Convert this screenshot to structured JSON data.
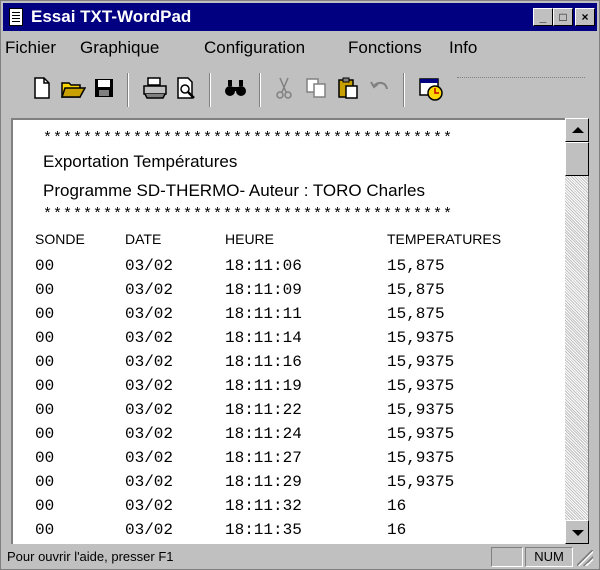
{
  "window": {
    "title": "Essai TXT-WordPad"
  },
  "titlebar_buttons": {
    "minimize": "_",
    "maximize": "□",
    "close": "×"
  },
  "menu": [
    "Fichier",
    "Graphique",
    "Configuration",
    "Fonctions",
    "Info"
  ],
  "toolbar": {
    "buttons": [
      "new-document",
      "open-folder",
      "save-disk",
      "print",
      "print-preview",
      "find-binoculars",
      "cut-scissors",
      "copy",
      "paste-clipboard",
      "undo",
      "insert-date-time"
    ]
  },
  "document": {
    "stars": "*****************************************",
    "title": "Exportation Températures",
    "subtitle": "Programme SD-THERMO- Auteur : TORO Charles",
    "columns": [
      "SONDE",
      "DATE",
      "HEURE",
      "TEMPERATURES"
    ],
    "rows": [
      [
        "00",
        "03/02",
        "18:11:06",
        "15,875"
      ],
      [
        "00",
        "03/02",
        "18:11:09",
        "15,875"
      ],
      [
        "00",
        "03/02",
        "18:11:11",
        "15,875"
      ],
      [
        "00",
        "03/02",
        "18:11:14",
        "15,9375"
      ],
      [
        "00",
        "03/02",
        "18:11:16",
        "15,9375"
      ],
      [
        "00",
        "03/02",
        "18:11:19",
        "15,9375"
      ],
      [
        "00",
        "03/02",
        "18:11:22",
        "15,9375"
      ],
      [
        "00",
        "03/02",
        "18:11:24",
        "15,9375"
      ],
      [
        "00",
        "03/02",
        "18:11:27",
        "15,9375"
      ],
      [
        "00",
        "03/02",
        "18:11:29",
        "15,9375"
      ],
      [
        "00",
        "03/02",
        "18:11:32",
        "16"
      ],
      [
        "00",
        "03/02",
        "18:11:35",
        "16"
      ]
    ]
  },
  "statusbar": {
    "help": "Pour ouvrir l'aide, presser F1",
    "num": "NUM"
  },
  "colors": {
    "titlebar": "#000080",
    "face": "#c0c0c0"
  }
}
